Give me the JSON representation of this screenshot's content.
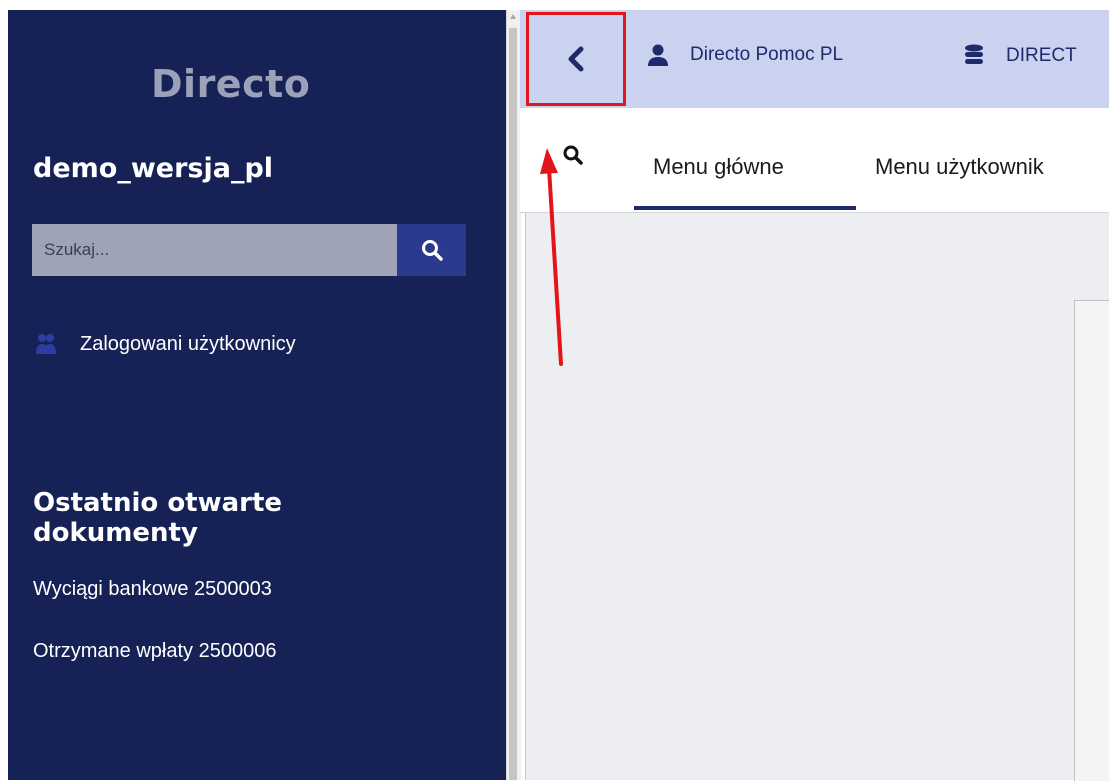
{
  "sidebar": {
    "logo": "Directo",
    "company": "demo_wersja_pl",
    "search": {
      "placeholder": "Szukaj..."
    },
    "logged_users_label": "Zalogowani użytkownicy",
    "recent": {
      "title": "Ostatnio otwarte dokumenty",
      "items": [
        "Wyciągi bankowe 2500003",
        "Otrzymane wpłaty 2500006"
      ]
    }
  },
  "header": {
    "user": "Directo Pomoc PL",
    "database": "DIRECT"
  },
  "tabs": [
    "Menu główne",
    "Menu użytkownik"
  ],
  "colors": {
    "sidebar_bg": "#162256",
    "header_bg": "#c9d3f0",
    "accent": "#1f2a6b",
    "highlight": "#e4141b"
  },
  "icons": [
    "search-icon",
    "chevron-left-icon",
    "user-icon",
    "database-icon",
    "users-icon"
  ]
}
